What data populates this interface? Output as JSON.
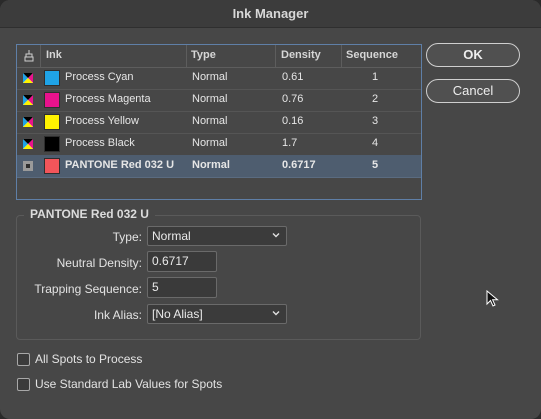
{
  "window": {
    "title": "Ink Manager"
  },
  "table": {
    "headers": {
      "ink": "Ink",
      "type": "Type",
      "density": "Density",
      "sequence": "Sequence"
    },
    "rows": [
      {
        "name": "Process Cyan",
        "type": "Normal",
        "density": "0.61",
        "sequence": "1",
        "color": "#1fa3e6",
        "icon": "process-ink-icon"
      },
      {
        "name": "Process Magenta",
        "type": "Normal",
        "density": "0.76",
        "sequence": "2",
        "color": "#e8128c",
        "icon": "process-ink-icon"
      },
      {
        "name": "Process Yellow",
        "type": "Normal",
        "density": "0.16",
        "sequence": "3",
        "color": "#fff200",
        "icon": "process-ink-icon"
      },
      {
        "name": "Process Black",
        "type": "Normal",
        "density": "1.7",
        "sequence": "4",
        "color": "#000000",
        "icon": "process-ink-icon"
      },
      {
        "name": "PANTONE Red 032 U",
        "type": "Normal",
        "density": "0.6717",
        "sequence": "5",
        "color": "#f2555a",
        "icon": "spot-ink-icon",
        "selected": true
      }
    ]
  },
  "buttons": {
    "ok": "OK",
    "cancel": "Cancel"
  },
  "details": {
    "group_title": "PANTONE Red 032 U",
    "type_label": "Type:",
    "type_value": "Normal",
    "neutral_density_label": "Neutral Density:",
    "neutral_density_value": "0.6717",
    "trapping_sequence_label": "Trapping Sequence:",
    "trapping_sequence_value": "5",
    "ink_alias_label": "Ink Alias:",
    "ink_alias_value": "[No Alias]"
  },
  "options": {
    "all_spots_to_process": {
      "label": "All Spots to Process",
      "checked": false
    },
    "standard_lab_values": {
      "label": "Use Standard Lab Values for Spots",
      "checked": false
    }
  }
}
